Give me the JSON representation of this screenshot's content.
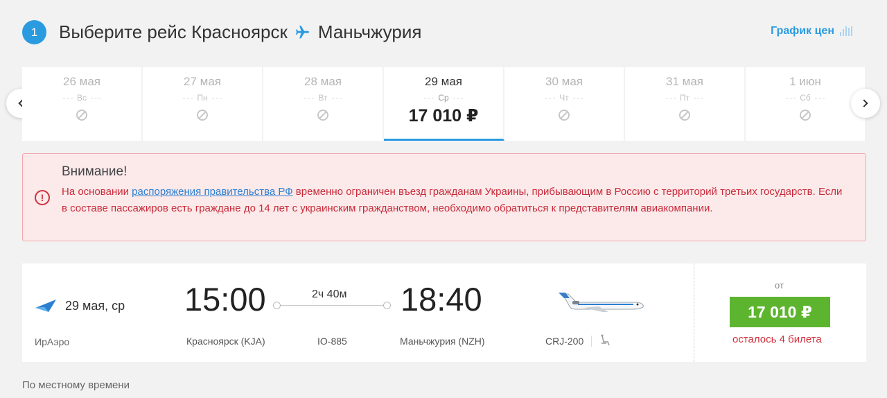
{
  "header": {
    "step": "1",
    "title_prefix": "Выберите рейс",
    "origin": "Красноярск",
    "destination": "Маньчжурия",
    "price_chart_label": "График цен"
  },
  "dates": [
    {
      "date": "26 мая",
      "weekday": "Вс",
      "available": false
    },
    {
      "date": "27 мая",
      "weekday": "Пн",
      "available": false
    },
    {
      "date": "28 мая",
      "weekday": "Вт",
      "available": false
    },
    {
      "date": "29 мая",
      "weekday": "Ср",
      "available": true,
      "price": "17 010 ₽",
      "selected": true
    },
    {
      "date": "30 мая",
      "weekday": "Чт",
      "available": false
    },
    {
      "date": "31 мая",
      "weekday": "Пт",
      "available": false
    },
    {
      "date": "1 июн",
      "weekday": "Сб",
      "available": false
    }
  ],
  "alert": {
    "title": "Внимание!",
    "text_before": "На основании ",
    "link_text": "распоряжения правительства РФ",
    "text_after": " временно ограничен въезд гражданам Украины, прибывающим в Россию с территорий третьих государств. Если в составе пассажиров есть граждане до 14 лет с украинским гражданством, необходимо обратиться к представителям авиакомпании."
  },
  "flight": {
    "date": "29 мая, ср",
    "airline": "ИрАэро",
    "departure_time": "15:00",
    "arrival_time": "18:40",
    "duration": "2ч 40м",
    "departure_city": "Красноярск (KJA)",
    "arrival_city": "Маньчжурия (NZH)",
    "flight_number": "IO-885",
    "aircraft": "CRJ-200",
    "price_prefix": "от",
    "price": "17 010 ₽",
    "seats_left": "осталось 4 билета"
  },
  "footer_note": "По местному времени",
  "colors": {
    "accent": "#2b9be0",
    "buy": "#5db42e",
    "alert_text": "#c72b39",
    "alert_bg": "#fce9ea"
  }
}
